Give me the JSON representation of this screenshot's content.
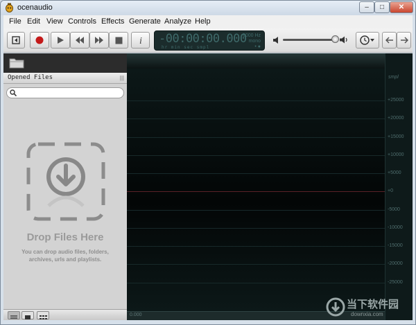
{
  "window": {
    "title": "ocenaudio"
  },
  "menu": [
    "File",
    "Edit",
    "View",
    "Controls",
    "Effects",
    "Generate",
    "Analyze",
    "Help"
  ],
  "display": {
    "time": "-00:00:00.000",
    "units": "hr  min  sec  smpl",
    "sample_rate": "8000 Hz",
    "channels": "mono",
    "mode": "• ●"
  },
  "sidebar": {
    "header": "Opened Files",
    "search_placeholder": "",
    "drop_title": "Drop Files Here",
    "drop_subtitle": "You can drop audio files, folders, archives, urls and playlists."
  },
  "ruler": {
    "unit": "smpl",
    "labels": [
      "+25000",
      "+20000",
      "+15000",
      "+10000",
      "+5000",
      "+0",
      "-5000",
      "-10000",
      "-15000",
      "-20000",
      "-25000"
    ]
  },
  "waveform": {
    "time_label": "0.000"
  },
  "watermark": {
    "text": "当下软件园",
    "sub": "downxia.com"
  },
  "colors": {
    "waveform_bg": "#0a1111",
    "zero_line": "#5a2228",
    "sidebar_bg": "#d3d3d3",
    "record": "#c41a1a"
  }
}
